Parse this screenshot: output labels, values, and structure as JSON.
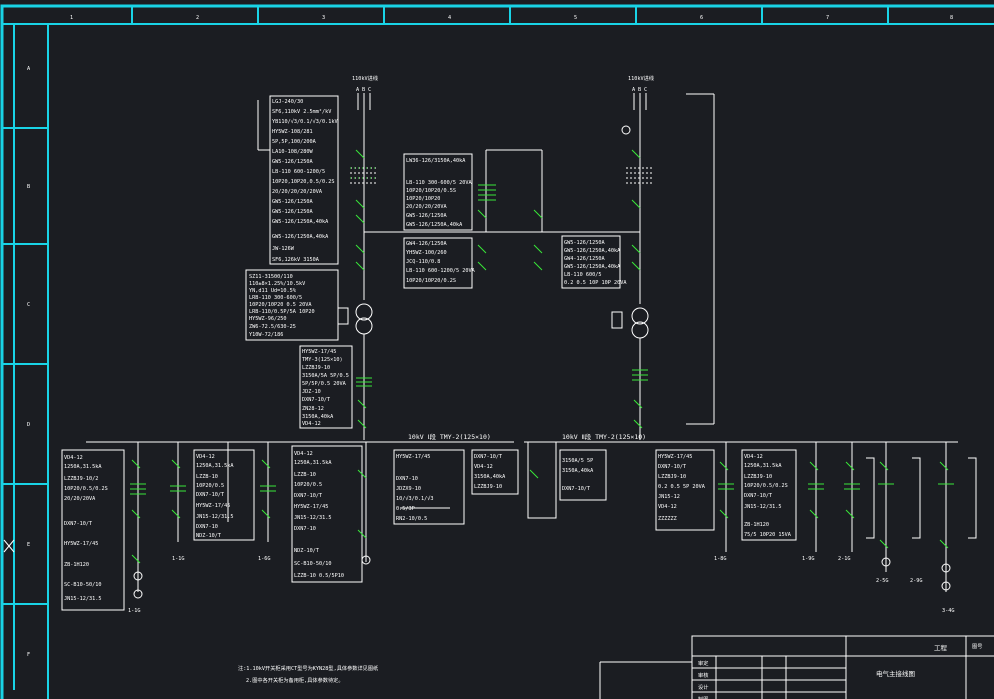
{
  "frame": {
    "top_zone_numbers": [
      "1",
      "2",
      "3",
      "4",
      "5",
      "6",
      "7",
      "8"
    ],
    "left_zone_letters": [
      "A",
      "B",
      "C",
      "D",
      "E",
      "F"
    ]
  },
  "incoming": {
    "left_title": "110kV进线",
    "right_title": "110kV进线",
    "phase_labels": [
      "A",
      "B",
      "C"
    ]
  },
  "left_column_specs": [
    "LGJ-240/30",
    "SF6,110kV 2.5mm²/kV",
    "YB110/√3/0.1/√3/0.1kV",
    "HY5WZ-108/281",
    "5P,5P,100/200A",
    "LA10-108/280W",
    "GW5-126/1250A",
    "LB-110 600-1200/5",
    "10P20,10P20,0.5/0.2S",
    "20/20/20/20/20VA",
    "GW5-126/1250A",
    "GW5-126/1250A",
    "GW5-126/1250A,40kA",
    "GW5-126/1250A,40kA",
    "JW-126W",
    "SF6,126kV 3150A"
  ],
  "middle_specs": [
    "LW36-126/3150A,40kA",
    "LB-110 300-600/5 20VA",
    "10P20/10P20/0.5S",
    "10P20/10P20",
    "20/20/20/20VA",
    "GW5-126/1250A",
    "GW5-126/1250A,40kA",
    "GW4-126/1250A",
    "YH5WZ-100/260",
    "JCQ-110/0.8",
    "LB-110 600-1200/5 20VA",
    "10P20/10P20/0.2S"
  ],
  "right_incoming_specs": [
    "GW5-126/1250A",
    "GW5-126/1250A,40kA",
    "GW4-126/1250A",
    "GW5-126/1250A,40kA",
    "LB-110 600/5",
    "0.2 0.5 10P 10P 20VA"
  ],
  "transformer_specs": [
    "SZ11-31500/110",
    "110±8×1.25%/10.5kV",
    "YN,d11 Ud=10.5%",
    "LRB-110 300-600/5",
    "10P20/10P20 0.5 20VA",
    "LRB-110/0.5P/5A 10P20",
    "HY5WZ-96/250",
    "ZW6-72.5/630-25",
    "Y10W-72/186"
  ],
  "lv_incomer_specs": [
    "HY5WZ-17/45",
    "TMY-3(125×10)",
    "LZZBJ9-10",
    "3150A/5A 5P/0.5",
    "5P/5P/0.5 20VA",
    "JDZ-10",
    "DXN7-10/T",
    "ZN28-12",
    "3150A,40kA",
    "VD4-12"
  ],
  "busbars": {
    "left_label": "10kV Ⅰ段 TMY-2(125×10)",
    "right_label": "10kV Ⅱ段 TMY-2(125×10)"
  },
  "feeder_left_specs": [
    "VD4-12",
    "1250A,31.5kA",
    "LZZBJ9-10/2",
    "10P20/0.5/0.2S",
    "20/20/20VA",
    "DXN7-10/T",
    "HY5WZ-17/45",
    "ZB-1H120",
    "SC-B10-50/10",
    "JN15-12/31.5"
  ],
  "feeder_mid_specs": [
    "VD4-12",
    "1250A,31.5kA",
    "LZZB-10",
    "10P20/0.5",
    "DXN7-10/T",
    "HY5WZ-17/45",
    "JN15-12/31.5",
    "DXN7-10",
    "NDZ-10/T",
    "SC-B10-50/10",
    "LZZB-10 0.5/5P10"
  ],
  "pt_cabinet_specs": [
    "HY5WZ-17/45",
    "DXN7-10",
    "JDZX9-10",
    "10/√3/0.1/√3",
    "0.5/3P",
    "RN2-10/0.5"
  ],
  "bus_tie_specs": [
    "DXN7-10/T",
    "VD4-12",
    "3150A,40kA",
    "LZZBJ9-10",
    "3150A/5 5P",
    "3150A,40kA",
    "DXN7-10/T"
  ],
  "right_feeder_specs": [
    "HY5WZ-17/45",
    "DXN7-10/T",
    "LZZBJ9-10",
    "0.2 0.5 5P 20VA",
    "JN15-12",
    "VD4-12",
    "ZZZZZZ",
    "VD4-12",
    "1250A,31.5kA",
    "LZZBJ9-10",
    "10P20/0.5/0.2S",
    "DXN7-10/T",
    "JN15-12/31.5",
    "ZB-1H120",
    "75/5 10P20 15VA"
  ],
  "feeder_labels": [
    "1-1G",
    "1-1G",
    "1-6G",
    "1-8G",
    "1-9G",
    "2-1G",
    "2-5G",
    "2-9G",
    "3-4G"
  ],
  "notes": {
    "line1": "注:1.10kV开关柜采用CT型号为KYN28型,具体参数详见图纸",
    "line2": "2.图中各开关柜为备用柜,具体参数待定。"
  },
  "title_block": {
    "project_label": "工程",
    "drawing_title": "电气主接线图",
    "role_1": "审定",
    "role_2": "审核",
    "role_3": "设计",
    "role_4": "制图",
    "corner_mark": "图号"
  },
  "colors": {
    "background": "#1b1d22",
    "frame": "#19d3e6",
    "lines": "#ffffff",
    "switches": "#39e639",
    "highlight": "#ff3030"
  }
}
